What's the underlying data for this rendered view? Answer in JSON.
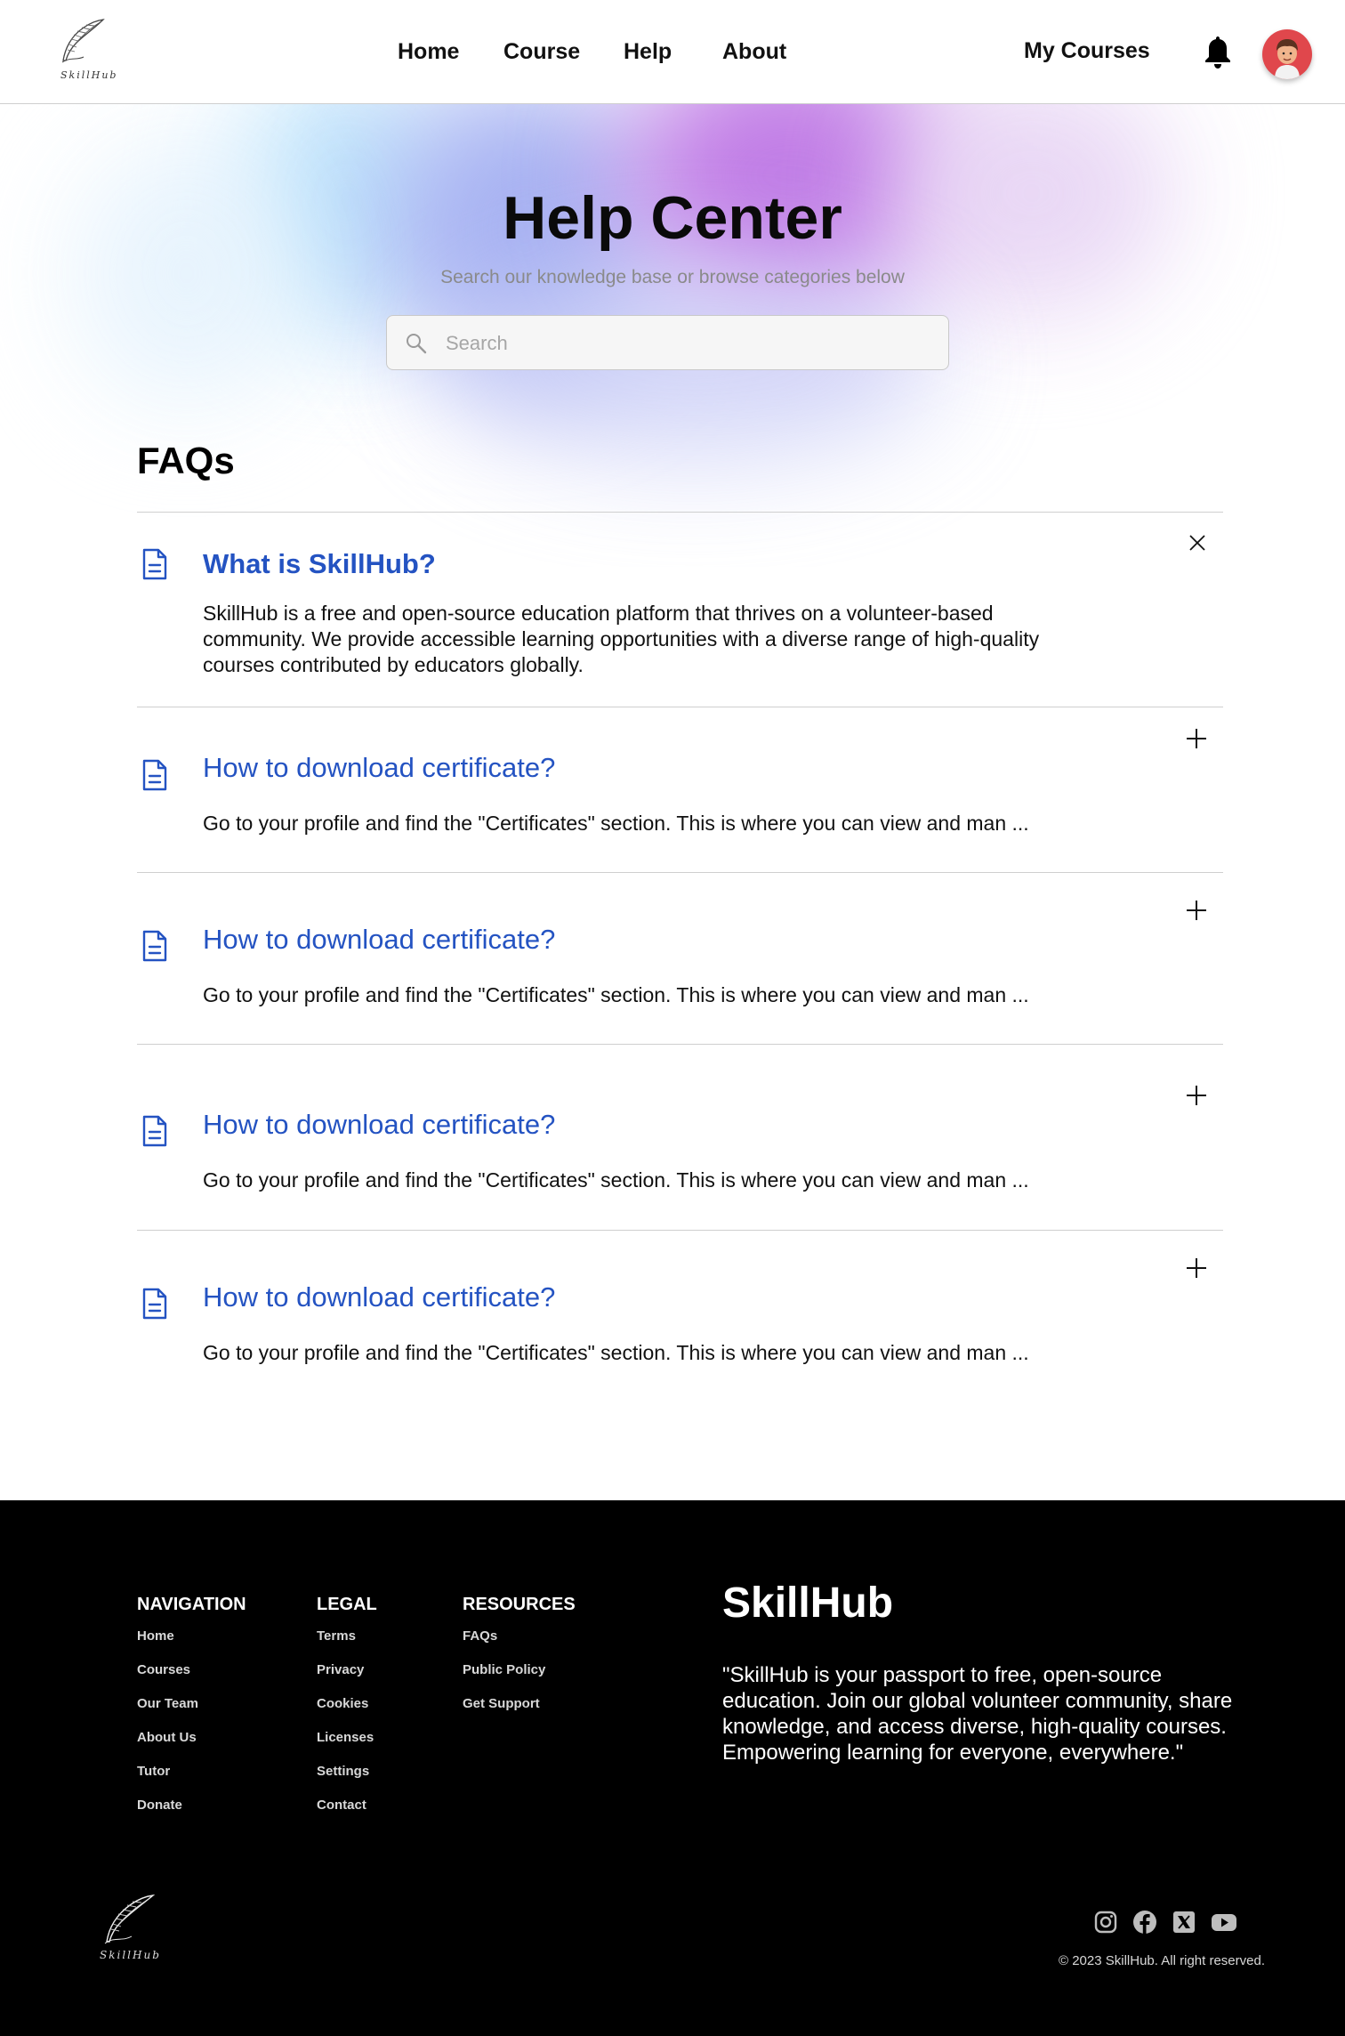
{
  "header": {
    "logo_text": "SkillHub",
    "nav": [
      "Home",
      "Course",
      "Help",
      "About"
    ],
    "my_courses": "My Courses"
  },
  "hero": {
    "title": "Help Center",
    "subtitle": "Search our knowledge base or browse categories below",
    "search_placeholder": "Search"
  },
  "faq": {
    "heading": "FAQs",
    "items": [
      {
        "question": "What is SkillHub?",
        "answer": "SkillHub is a free and open-source education platform that thrives on a volunteer-based community. We provide accessible learning opportunities with a diverse range of high-quality courses contributed by educators globally.",
        "expanded": true
      },
      {
        "question": "How to download certificate?",
        "answer": "Go to your profile and find the \"Certificates\" section. This is where you can view and man ...",
        "expanded": false
      },
      {
        "question": "How to download certificate?",
        "answer": "Go to your profile and find the \"Certificates\" section. This is where you can view and man ...",
        "expanded": false
      },
      {
        "question": "How to download certificate?",
        "answer": "Go to your profile and find the \"Certificates\" section. This is where you can view and man ...",
        "expanded": false
      },
      {
        "question": "How to download certificate?",
        "answer": "Go to your profile and find the \"Certificates\" section. This is where you can view and man ...",
        "expanded": false
      }
    ]
  },
  "footer": {
    "navigation": {
      "title": "NAVIGATION",
      "links": [
        "Home",
        "Courses",
        "Our Team",
        "About Us",
        "Tutor",
        "Donate"
      ]
    },
    "legal": {
      "title": "LEGAL",
      "links": [
        "Terms",
        "Privacy",
        "Cookies",
        "Licenses",
        "Settings",
        "Contact"
      ]
    },
    "resources": {
      "title": "RESOURCES",
      "links": [
        "FAQs",
        "Public Policy",
        "Get Support"
      ]
    },
    "brand": "SkillHub",
    "description": "\"SkillHub is your passport to free, open-source education. Join our global volunteer community, share knowledge, and access diverse, high-quality courses. Empowering learning for everyone, everywhere.\"",
    "logo_text": "SkillHub",
    "social_icons": [
      "instagram-icon",
      "facebook-icon",
      "x-icon",
      "youtube-icon"
    ],
    "copyright": "© 2023 SkillHub. All right reserved."
  },
  "colors": {
    "link_blue": "#2453c2",
    "footer_bg": "#000000",
    "avatar_bg": "#e0474c"
  }
}
